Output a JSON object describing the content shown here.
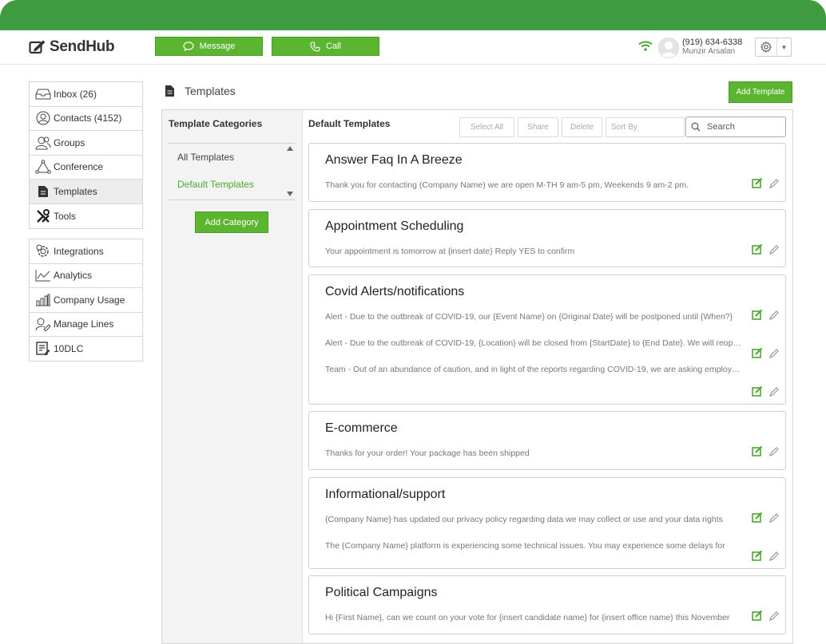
{
  "app": {
    "name": "SendHub"
  },
  "header": {
    "message_label": "Message",
    "call_label": "Call",
    "phone": "(919) 634-6338",
    "user_name": "Munzir Arsalan"
  },
  "nav_primary": [
    {
      "label": "Inbox (26)",
      "icon": "inbox-icon"
    },
    {
      "label": "Contacts (4152)",
      "icon": "contacts-icon"
    },
    {
      "label": "Groups",
      "icon": "groups-icon"
    },
    {
      "label": "Conference",
      "icon": "conference-icon"
    },
    {
      "label": "Templates",
      "icon": "templates-icon",
      "active": true
    },
    {
      "label": "Tools",
      "icon": "tools-icon"
    }
  ],
  "nav_secondary": [
    {
      "label": "Integrations",
      "icon": "integrations-icon"
    },
    {
      "label": "Analytics",
      "icon": "analytics-icon"
    },
    {
      "label": "Company Usage",
      "icon": "company-usage-icon"
    },
    {
      "label": "Manage Lines",
      "icon": "manage-lines-icon"
    },
    {
      "label": "10DLC",
      "icon": "10dlc-icon"
    }
  ],
  "page": {
    "title": "Templates",
    "add_template_label": "Add Template"
  },
  "categories": {
    "heading": "Template Categories",
    "items": [
      "All Templates",
      "Default Templates"
    ],
    "selected": "Default Templates",
    "add_label": "Add Category"
  },
  "templates_panel": {
    "heading": "Default Templates",
    "select_all_label": "Select All",
    "share_label": "Share",
    "delete_label": "Delete",
    "sort_by_label": "Sort By",
    "search_placeholder": "Search"
  },
  "template_groups": [
    {
      "title": "Answer Faq In A Breeze",
      "messages": [
        "Thank you for contacting (Company Name) we are open M-TH 9 am-5 pm, Weekends 9 am-2 pm."
      ]
    },
    {
      "title": "Appointment Scheduling",
      "messages": [
        "Your appointment is tomorrow at {insert date} Reply YES to confirm"
      ]
    },
    {
      "title": "Covid Alerts/notifications",
      "messages": [
        "Alert - Due to the outbreak of COVID-19, our {Event Name} on {Original Date} will be postponed until {When?}",
        "Alert - Due to the outbreak of COVID-19, {Location} will be closed from {StartDate} to {End Date}. We will reopen",
        "Team - Out of an abundance of caution, and in light of the reports regarding COVID-19, we are asking employees"
      ]
    },
    {
      "title": "E-commerce",
      "messages": [
        "Thanks for your order! Your package has been shipped"
      ]
    },
    {
      "title": "Informational/support",
      "messages": [
        "{Company Name} has updated our privacy policy regarding data we may collect or use and your data rights",
        "The {Company Name} platform is experiencing some technical issues. You may experience some delays for"
      ]
    },
    {
      "title": "Political Campaigns",
      "messages": [
        "Hi {First Name}, can we count on your vote for {insert candidate name} for {insert office name} this November"
      ]
    }
  ],
  "colors": {
    "brand_green": "#5cb531",
    "topbar_green": "#3e9b3f",
    "link_green": "#4aa92f"
  }
}
